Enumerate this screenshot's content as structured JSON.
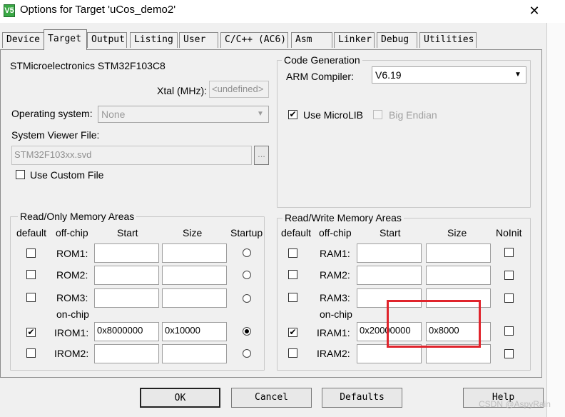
{
  "window": {
    "title": "Options for Target 'uCos_demo2'",
    "icon": "V5",
    "close_label": "✕"
  },
  "tabs": [
    {
      "label": "Device"
    },
    {
      "label": "Target"
    },
    {
      "label": "Output"
    },
    {
      "label": "Listing"
    },
    {
      "label": "User"
    },
    {
      "label": "C/C++ (AC6)"
    },
    {
      "label": "Asm"
    },
    {
      "label": "Linker"
    },
    {
      "label": "Debug"
    },
    {
      "label": "Utilities"
    }
  ],
  "device": "STMicroelectronics STM32F103C8",
  "xtal": {
    "label": "Xtal (MHz):",
    "value": "<undefined>"
  },
  "os": {
    "label": "Operating system:",
    "value": "None"
  },
  "svd": {
    "label": "System Viewer File:",
    "value": "STM32F103xx.svd",
    "browse": "..."
  },
  "custom_file": {
    "label": "Use Custom File",
    "checked": false
  },
  "codegen": {
    "title": "Code Generation",
    "compiler_label": "ARM Compiler:",
    "compiler_value": "V6.19",
    "microlib": {
      "label": "Use MicroLIB",
      "checked": true
    },
    "bigendian": {
      "label": "Big Endian",
      "checked": false
    }
  },
  "ro_mem": {
    "title": "Read/Only Memory Areas",
    "headers": {
      "default": "default",
      "offchip": "off-chip",
      "start": "Start",
      "size": "Size",
      "startup": "Startup"
    },
    "onchip_label": "on-chip",
    "rows": [
      {
        "name": "ROM1:",
        "start": "",
        "size": "",
        "default": false,
        "startup": false
      },
      {
        "name": "ROM2:",
        "start": "",
        "size": "",
        "default": false,
        "startup": false
      },
      {
        "name": "ROM3:",
        "start": "",
        "size": "",
        "default": false,
        "startup": false
      },
      {
        "name": "IROM1:",
        "start": "0x8000000",
        "size": "0x10000",
        "default": true,
        "startup": true
      },
      {
        "name": "IROM2:",
        "start": "",
        "size": "",
        "default": false,
        "startup": false
      }
    ]
  },
  "rw_mem": {
    "title": "Read/Write Memory Areas",
    "headers": {
      "default": "default",
      "offchip": "off-chip",
      "start": "Start",
      "size": "Size",
      "noinit": "NoInit"
    },
    "onchip_label": "on-chip",
    "rows": [
      {
        "name": "RAM1:",
        "start": "",
        "size": "",
        "default": false,
        "noinit": false
      },
      {
        "name": "RAM2:",
        "start": "",
        "size": "",
        "default": false,
        "noinit": false
      },
      {
        "name": "RAM3:",
        "start": "",
        "size": "",
        "default": false,
        "noinit": false
      },
      {
        "name": "IRAM1:",
        "start": "0x20000000",
        "size": "0x8000",
        "default": true,
        "noinit": false
      },
      {
        "name": "IRAM2:",
        "start": "",
        "size": "",
        "default": false,
        "noinit": false
      }
    ]
  },
  "buttons": {
    "ok": "OK",
    "cancel": "Cancel",
    "defaults": "Defaults",
    "help": "Help"
  },
  "watermark": "CSDN @AspyRain",
  "colors": {
    "highlight": "#e0242c",
    "icon_bg": "#3aa845"
  }
}
